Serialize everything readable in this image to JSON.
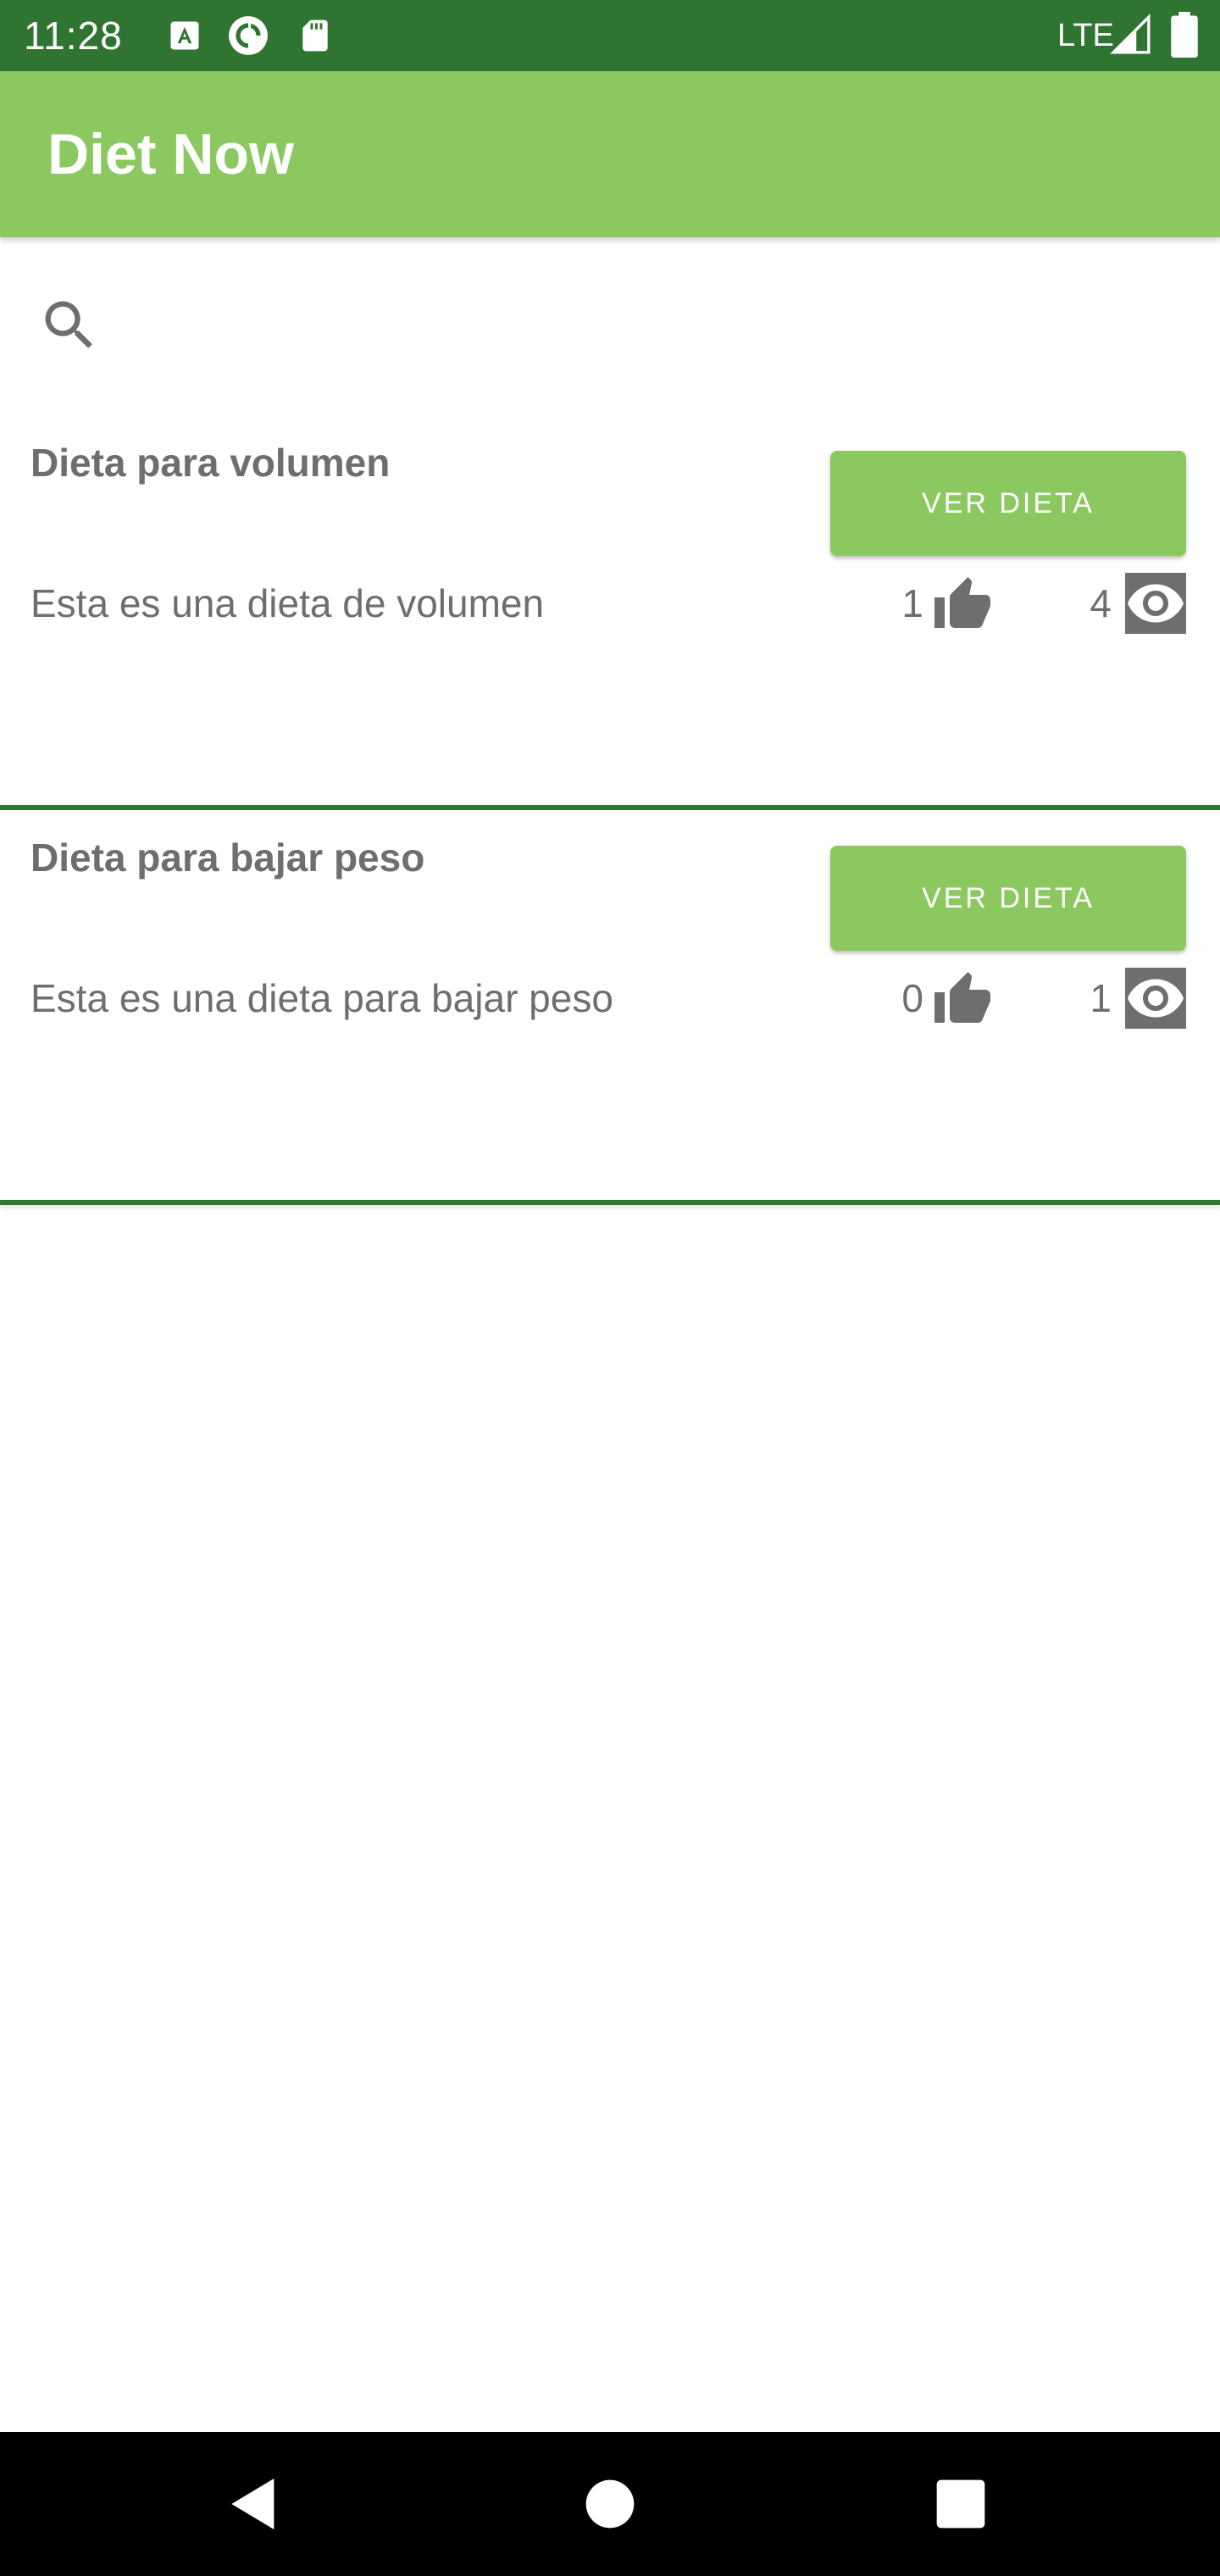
{
  "status_bar": {
    "time": "11:28",
    "network": "LTE",
    "notification_icons": [
      "font-a-icon",
      "pocket-casts-icon",
      "sd-card-icon"
    ],
    "right_icons": [
      "signal-icon",
      "battery-icon"
    ],
    "background_color": "#2f7431"
  },
  "app_bar": {
    "title": "Diet Now",
    "background_color": "#8bc960"
  },
  "search": {
    "icon": "search-icon"
  },
  "diets": [
    {
      "title": "Dieta para volumen",
      "button_label": "VER DIETA",
      "description": "Esta es una dieta de volumen",
      "likes": "1",
      "views": "4"
    },
    {
      "title": "Dieta para bajar peso",
      "button_label": "VER DIETA",
      "description": "Esta es una dieta para bajar peso",
      "likes": "0",
      "views": "1"
    }
  ],
  "colors": {
    "accent": "#8bc960",
    "primary_dark": "#2f7431",
    "text": "#6e6e6e"
  },
  "nav_bar": {
    "buttons": [
      "back-icon",
      "home-icon",
      "recents-icon"
    ]
  }
}
